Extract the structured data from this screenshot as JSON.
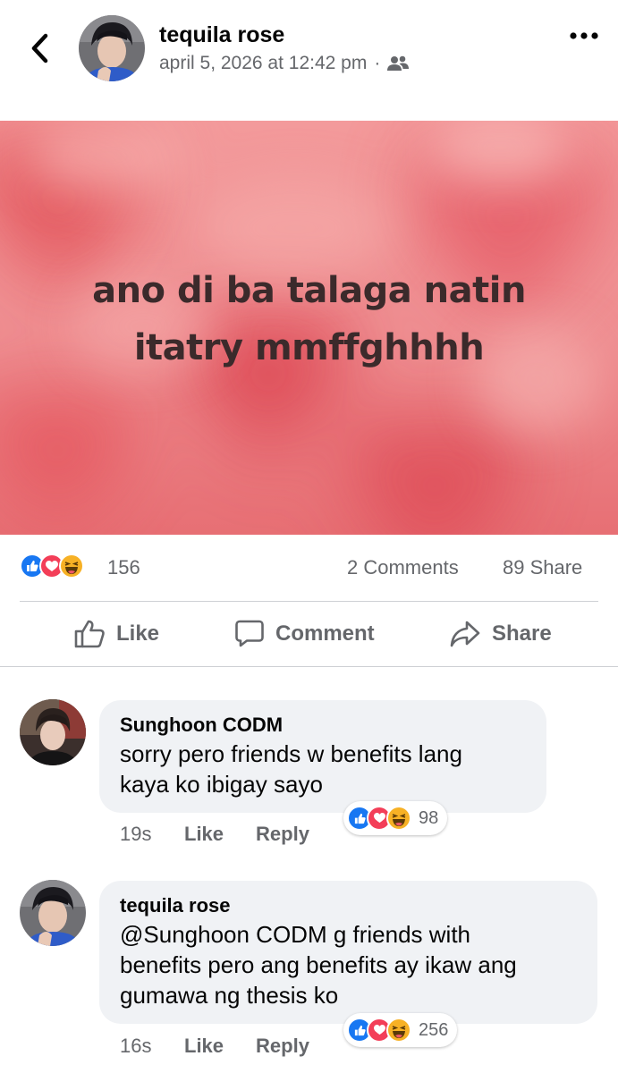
{
  "header": {
    "author": "tequila rose",
    "timestamp": "april 5, 2026 at 12:42 pm",
    "separator": "·",
    "audience_icon": "friends-icon"
  },
  "post": {
    "lines": [
      "ano di ba talaga natin",
      "itatry mmffghhhh"
    ],
    "background": "pink-hearts-gradient"
  },
  "summary": {
    "reactions": [
      "like",
      "love",
      "haha"
    ],
    "reaction_count": "156",
    "comments": "2 Comments",
    "shares": "89 Share"
  },
  "actions": {
    "like": "Like",
    "comment": "Comment",
    "share": "Share"
  },
  "comments": [
    {
      "author": "Sunghoon CODM",
      "lines": [
        "sorry pero friends w benefits lang",
        "kaya ko ibigay sayo"
      ],
      "time": "19s",
      "like": "Like",
      "reply": "Reply",
      "reaction_count": "98"
    },
    {
      "author": "tequila rose",
      "lines": [
        "@Sunghoon CODM g friends with",
        "benefits pero ang benefits ay ikaw ang",
        "gumawa ng thesis ko"
      ],
      "time": "16s",
      "like": "Like",
      "reply": "Reply",
      "reaction_count": "256"
    }
  ],
  "colors": {
    "like_blue": "#1877f2",
    "love_red": "#f33e58",
    "haha_yellow": "#f7b125",
    "secondary_text": "#65676b",
    "bubble_bg": "#f0f2f5"
  }
}
